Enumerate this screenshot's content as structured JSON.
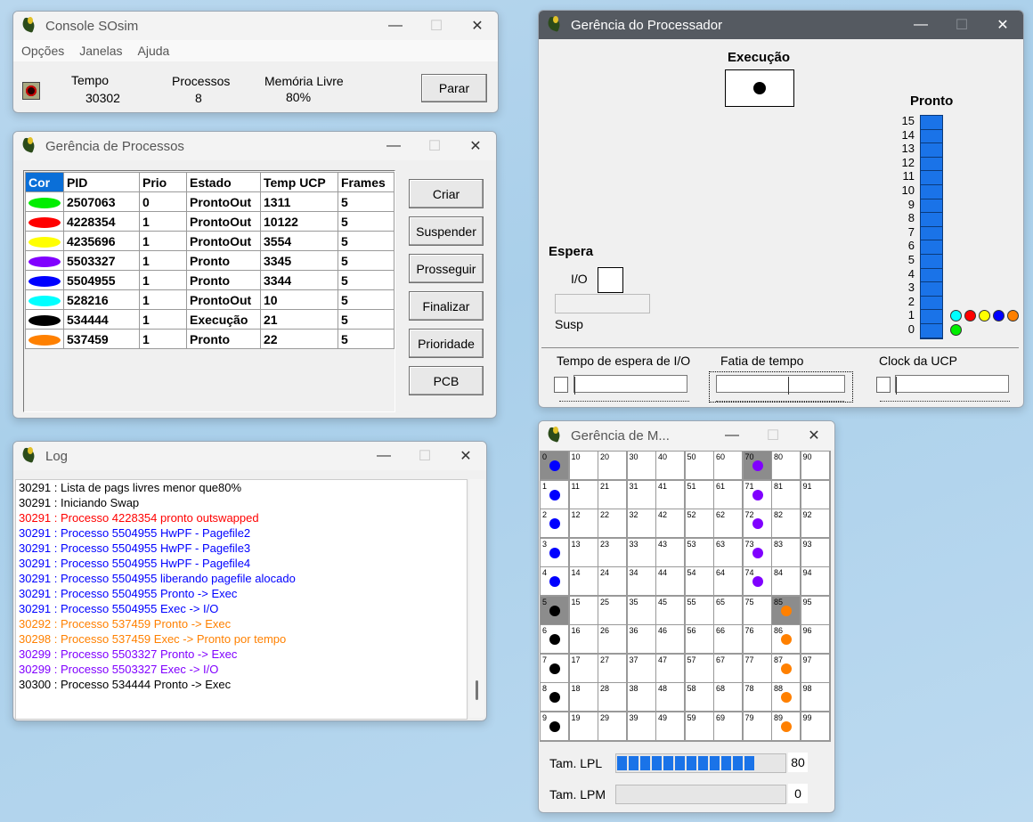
{
  "console": {
    "title": "Console SOsim",
    "menu": [
      "Opções",
      "Janelas",
      "Ajuda"
    ],
    "tempo_label": "Tempo",
    "tempo_value": "30302",
    "processos_label": "Processos",
    "processos_value": "8",
    "memoria_label": "Memória Livre",
    "memoria_value": "80%",
    "parar_label": "Parar"
  },
  "processos": {
    "title": "Gerência de Processos",
    "headers": [
      "Cor",
      "PID",
      "Prio",
      "Estado",
      "Temp UCP",
      "Frames"
    ],
    "rows": [
      {
        "color": "#00ee00",
        "pid": "2507063",
        "prio": "0",
        "estado": "ProntoOut",
        "ucp": "1311",
        "frames": "5"
      },
      {
        "color": "#ff0000",
        "pid": "4228354",
        "prio": "1",
        "estado": "ProntoOut",
        "ucp": "10122",
        "frames": "5"
      },
      {
        "color": "#ffff00",
        "pid": "4235696",
        "prio": "1",
        "estado": "ProntoOut",
        "ucp": "3554",
        "frames": "5"
      },
      {
        "color": "#8000ff",
        "pid": "5503327",
        "prio": "1",
        "estado": "Pronto",
        "ucp": "3345",
        "frames": "5"
      },
      {
        "color": "#0000ff",
        "pid": "5504955",
        "prio": "1",
        "estado": "Pronto",
        "ucp": "3344",
        "frames": "5"
      },
      {
        "color": "#00ffff",
        "pid": "528216",
        "prio": "1",
        "estado": "ProntoOut",
        "ucp": "10",
        "frames": "5"
      },
      {
        "color": "#000000",
        "pid": "534444",
        "prio": "1",
        "estado": "Execução",
        "ucp": "21",
        "frames": "5"
      },
      {
        "color": "#ff8000",
        "pid": "537459",
        "prio": "1",
        "estado": "Pronto",
        "ucp": "22",
        "frames": "5"
      }
    ],
    "buttons": [
      "Criar",
      "Suspender",
      "Prosseguir",
      "Finalizar",
      "Prioridade",
      "PCB"
    ]
  },
  "log": {
    "title": "Log",
    "lines": [
      {
        "text": "30291 : Lista de pags livres menor que80%",
        "color": "#000000"
      },
      {
        "text": "30291 : Iniciando Swap",
        "color": "#000000"
      },
      {
        "text": "30291 : Processo 4228354 pronto outswapped",
        "color": "#ff0000"
      },
      {
        "text": "30291 : Processo 5504955 HwPF - Pagefile2",
        "color": "#0000ff"
      },
      {
        "text": "30291 : Processo 5504955 HwPF - Pagefile3",
        "color": "#0000ff"
      },
      {
        "text": "30291 : Processo 5504955 HwPF - Pagefile4",
        "color": "#0000ff"
      },
      {
        "text": "30291 : Processo 5504955 liberando pagefile alocado",
        "color": "#0000ff"
      },
      {
        "text": "30291 : Processo 5504955 Pronto -> Exec",
        "color": "#0000ff"
      },
      {
        "text": "30291 : Processo 5504955 Exec -> I/O",
        "color": "#0000ff"
      },
      {
        "text": "30292 : Processo 537459 Pronto -> Exec",
        "color": "#ff8000"
      },
      {
        "text": "30298 : Processo 537459 Exec -> Pronto por tempo",
        "color": "#ff8000"
      },
      {
        "text": "30299 : Processo 5503327 Pronto -> Exec",
        "color": "#8000ff"
      },
      {
        "text": "30299 : Processo 5503327 Exec -> I/O",
        "color": "#8000ff"
      },
      {
        "text": "30300 : Processo 534444 Pronto -> Exec",
        "color": "#000000"
      }
    ]
  },
  "processador": {
    "title": "Gerência do Processador",
    "execucao_label": "Execução",
    "pronto_label": "Pronto",
    "espera_label": "Espera",
    "io_label": "I/O",
    "susp_label": "Susp",
    "queue_numbers": [
      "15",
      "14",
      "13",
      "12",
      "11",
      "10",
      "9",
      "8",
      "7",
      "6",
      "5",
      "4",
      "3",
      "2",
      "1",
      "0"
    ],
    "queue_row1_colors": [
      "#00ffff",
      "#ff0000",
      "#ffff00",
      "#0000ff",
      "#ff8000"
    ],
    "queue_row0_colors": [
      "#00ee00"
    ],
    "slider_io_label": "Tempo de espera de I/O",
    "slider_fatia_label": "Fatia de tempo",
    "slider_clock_label": "Clock da UCP"
  },
  "memoria": {
    "title": "Gerência de M...",
    "lpl_label": "Tam. LPL",
    "lpl_value": "80",
    "lpl_fill": 0.8,
    "lpm_label": "Tam. LPM",
    "lpm_value": "0",
    "gray_cells": [
      "0",
      "5",
      "70",
      "85"
    ],
    "cell_colors": {
      "0": "#0000ff",
      "1": "#0000ff",
      "2": "#0000ff",
      "3": "#0000ff",
      "4": "#0000ff",
      "5": "#000000",
      "6": "#000000",
      "7": "#000000",
      "8": "#000000",
      "9": "#000000",
      "70": "#8000ff",
      "71": "#8000ff",
      "72": "#8000ff",
      "73": "#8000ff",
      "74": "#8000ff",
      "85": "#ff8000",
      "86": "#ff8000",
      "87": "#ff8000",
      "88": "#ff8000",
      "89": "#ff8000"
    }
  }
}
